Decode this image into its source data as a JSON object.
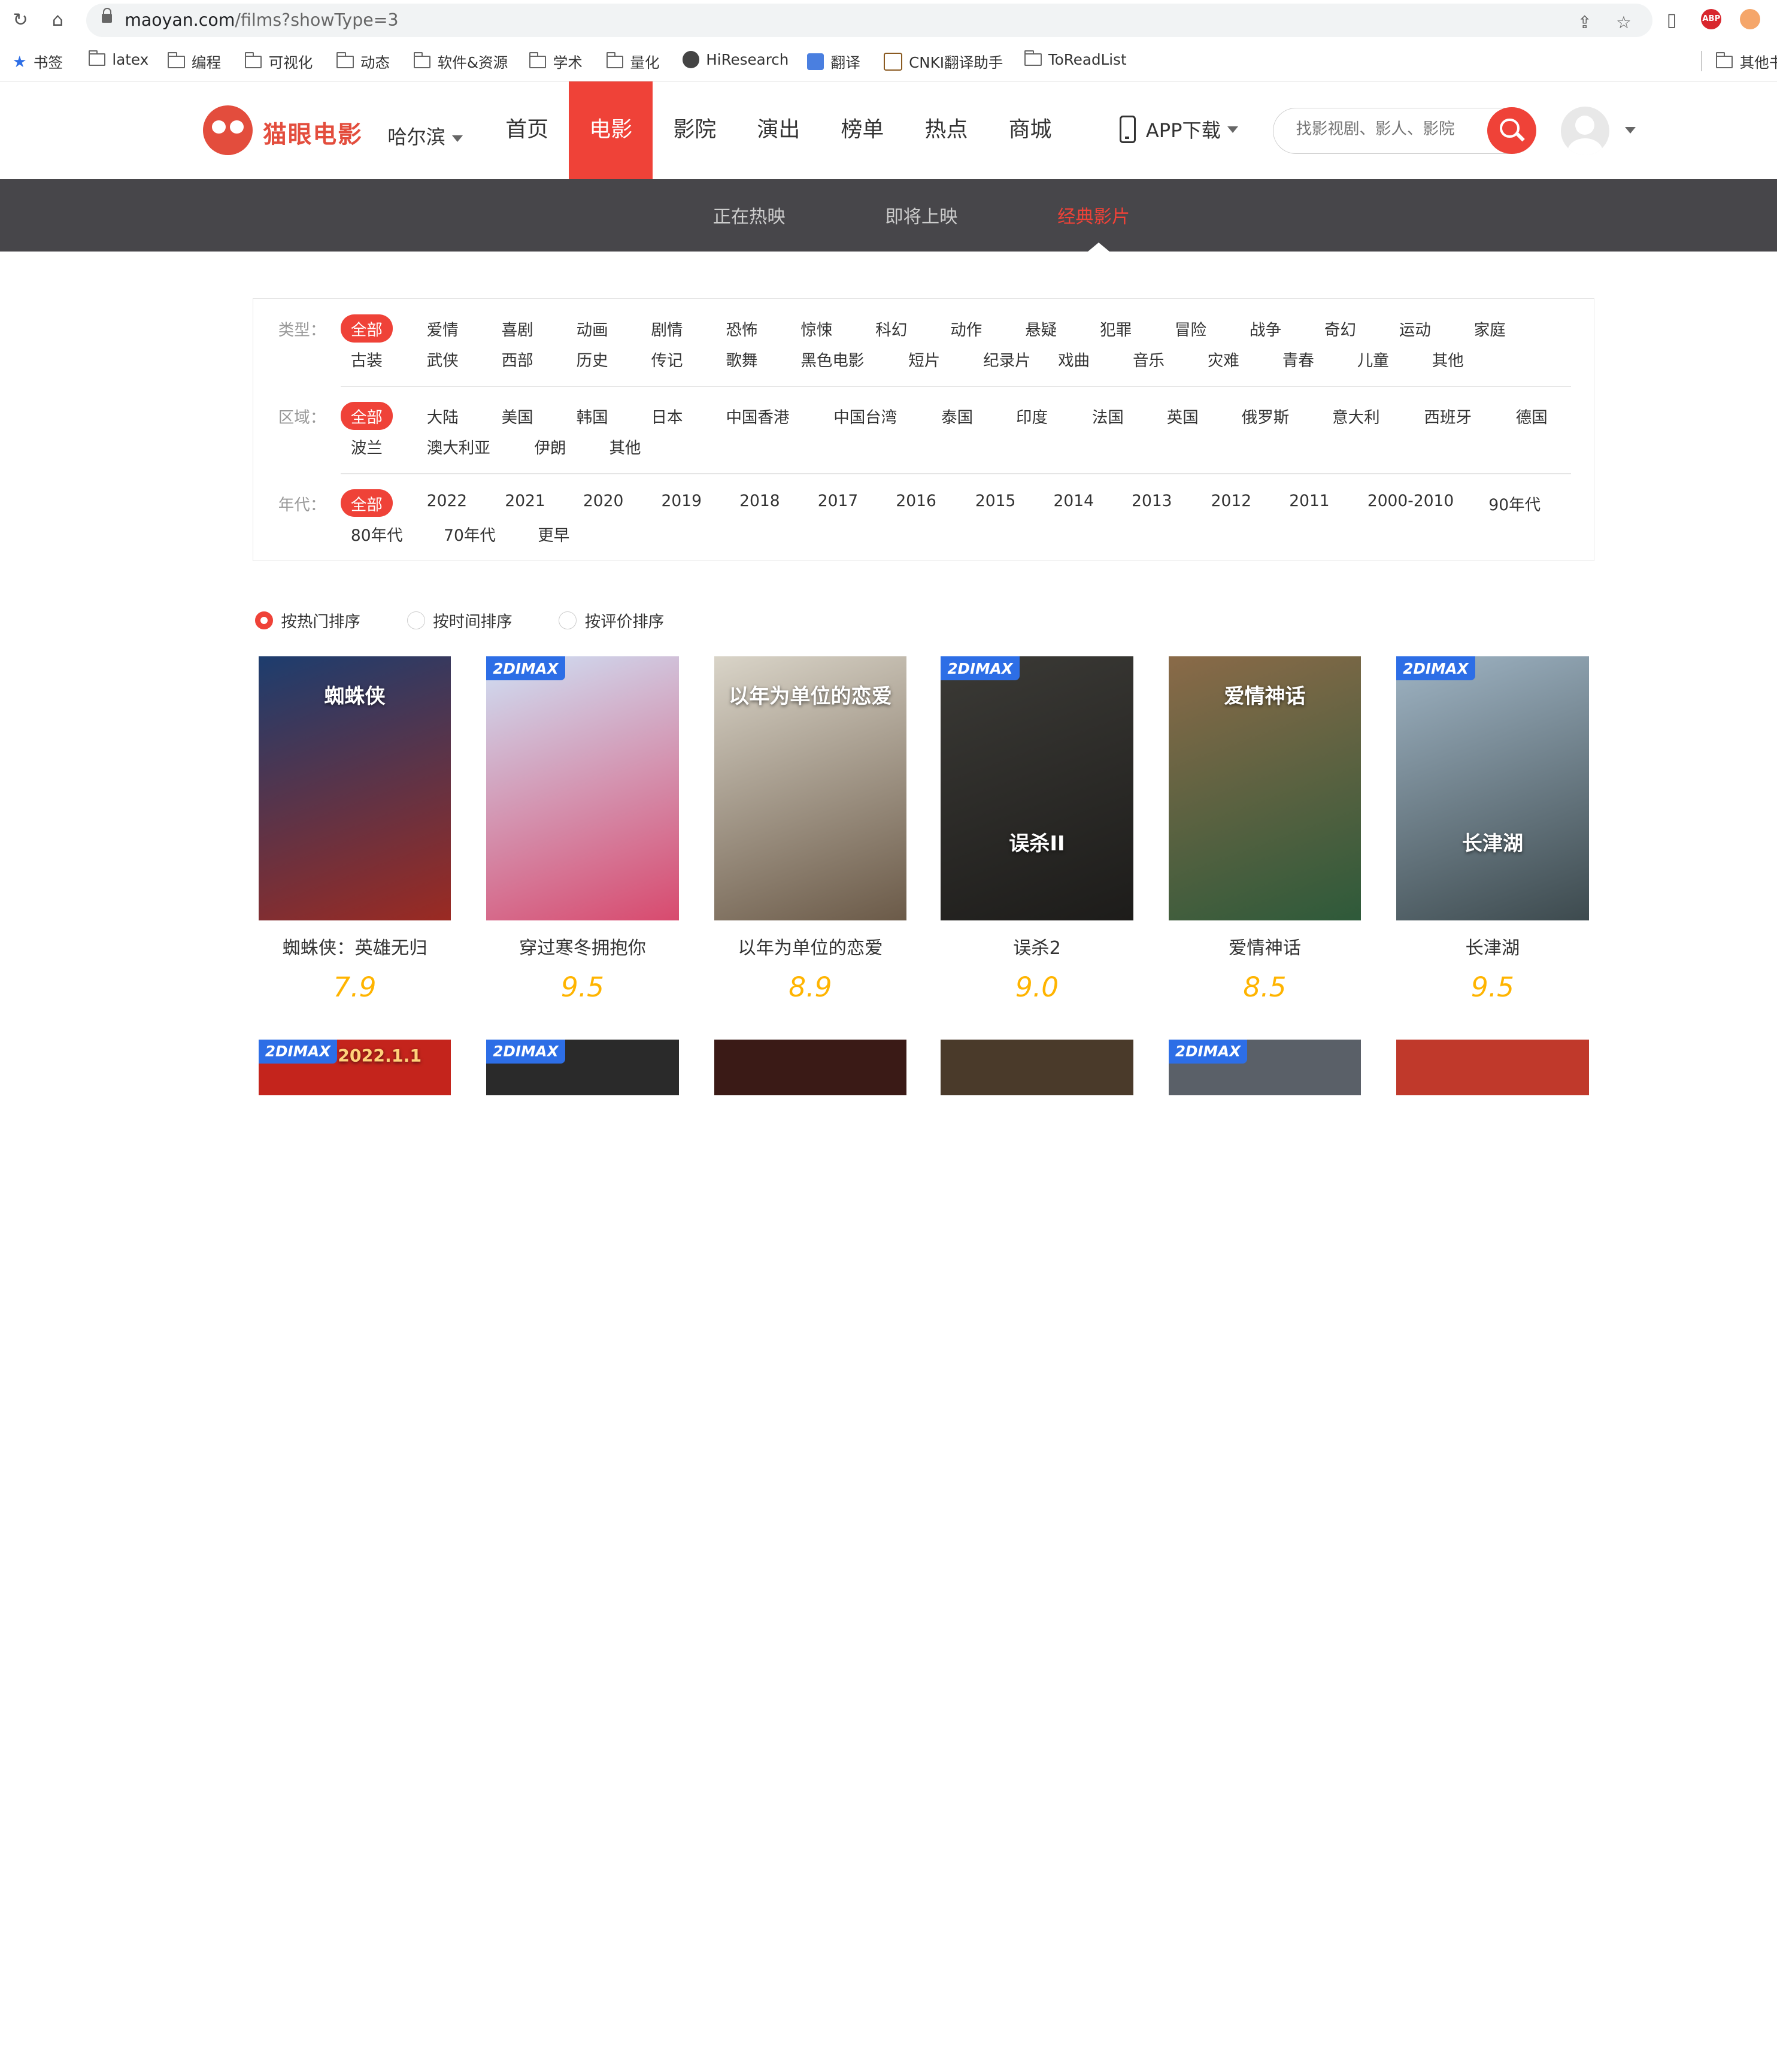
{
  "browser": {
    "url_host": "maoyan.com",
    "url_path": "/films?showType=3",
    "bookmarks": [
      {
        "label": "书签",
        "icon": "star-icon"
      },
      {
        "label": "latex",
        "icon": "folder-icon"
      },
      {
        "label": "编程",
        "icon": "folder-icon"
      },
      {
        "label": "可视化",
        "icon": "folder-icon"
      },
      {
        "label": "动态",
        "icon": "folder-icon"
      },
      {
        "label": "软件&资源",
        "icon": "folder-icon"
      },
      {
        "label": "学术",
        "icon": "folder-icon"
      },
      {
        "label": "量化",
        "icon": "folder-icon"
      },
      {
        "label": "HiResearch",
        "icon": "globe-icon"
      },
      {
        "label": "翻译",
        "icon": "translate-icon"
      },
      {
        "label": "CNKI翻译助手",
        "icon": "cnki-icon"
      },
      {
        "label": "ToReadList",
        "icon": "folder-icon"
      },
      {
        "label": "其他书签",
        "icon": "folder-icon"
      }
    ],
    "abp_label": "ABP"
  },
  "header": {
    "logo_text": "猫眼电影",
    "city": "哈尔滨",
    "nav": [
      "首页",
      "电影",
      "影院",
      "演出",
      "榜单",
      "热点",
      "商城"
    ],
    "active_nav": "电影",
    "app_download": "APP下载",
    "search_placeholder": "找影视剧、影人、影院"
  },
  "subnav": {
    "items": [
      "正在热映",
      "即将上映",
      "经典影片"
    ],
    "active": "经典影片"
  },
  "filters": {
    "type": {
      "label": "类型：",
      "tags": [
        "全部",
        "爱情",
        "喜剧",
        "动画",
        "剧情",
        "恐怖",
        "惊悚",
        "科幻",
        "动作",
        "悬疑",
        "犯罪",
        "冒险",
        "战争",
        "奇幻",
        "运动",
        "家庭",
        "古装",
        "武侠",
        "西部",
        "历史",
        "传记",
        "歌舞",
        "黑色电影",
        "短片",
        "纪录片",
        "戏曲",
        "音乐",
        "灾难",
        "青春",
        "儿童",
        "其他"
      ]
    },
    "region": {
      "label": "区域：",
      "tags": [
        "全部",
        "大陆",
        "美国",
        "韩国",
        "日本",
        "中国香港",
        "中国台湾",
        "泰国",
        "印度",
        "法国",
        "英国",
        "俄罗斯",
        "意大利",
        "西班牙",
        "德国",
        "波兰",
        "澳大利亚",
        "伊朗",
        "其他"
      ]
    },
    "year": {
      "label": "年代：",
      "tags": [
        "全部",
        "2022",
        "2021",
        "2020",
        "2019",
        "2018",
        "2017",
        "2016",
        "2015",
        "2014",
        "2013",
        "2012",
        "2011",
        "2000-2010",
        "90年代",
        "80年代",
        "70年代",
        "更早"
      ]
    }
  },
  "sort": {
    "options": [
      "按热门排序",
      "按时间排序",
      "按评价排序"
    ],
    "selected": "按热门排序"
  },
  "movies": [
    {
      "name": "蜘蛛侠：英雄无归",
      "score": "7.9",
      "badge": "",
      "poster_text": "蜘蛛侠",
      "color1": "#1d3d6e",
      "color2": "#9b2a22"
    },
    {
      "name": "穿过寒冬拥抱你",
      "score": "9.5",
      "badge": "2DIMAX",
      "poster_text": "",
      "color1": "#cfe0f5",
      "color2": "#d84a6e"
    },
    {
      "name": "以年为单位的恋爱",
      "score": "8.9",
      "badge": "",
      "poster_text": "以年为单位的恋爱",
      "color1": "#d9d4c8",
      "color2": "#6b5a48"
    },
    {
      "name": "误杀2",
      "score": "9.0",
      "badge": "2DIMAX",
      "poster_text": "误杀II",
      "color1": "#3b3a36",
      "color2": "#1d1c1a"
    },
    {
      "name": "爱情神话",
      "score": "8.5",
      "badge": "",
      "poster_text": "爱情神话",
      "color1": "#8a6a48",
      "color2": "#2e5a3a"
    },
    {
      "name": "长津湖",
      "score": "9.5",
      "badge": "2DIMAX",
      "poster_text": "长津湖",
      "color1": "#9fb4c4",
      "color2": "#3d4a4e"
    }
  ],
  "movies_row2": [
    {
      "badge": "2DIMAX",
      "poster_text": "2022.1.1",
      "color1": "#c4241c"
    },
    {
      "badge": "2DIMAX",
      "poster_text": "",
      "color1": "#2a2a2a"
    },
    {
      "badge": "",
      "poster_text": "",
      "color1": "#3a1a16"
    },
    {
      "badge": "",
      "poster_text": "",
      "color1": "#4a3a2a"
    },
    {
      "badge": "2DIMAX",
      "poster_text": "",
      "color1": "#5a6068"
    },
    {
      "badge": "",
      "poster_text": "",
      "color1": "#c0392b"
    }
  ]
}
